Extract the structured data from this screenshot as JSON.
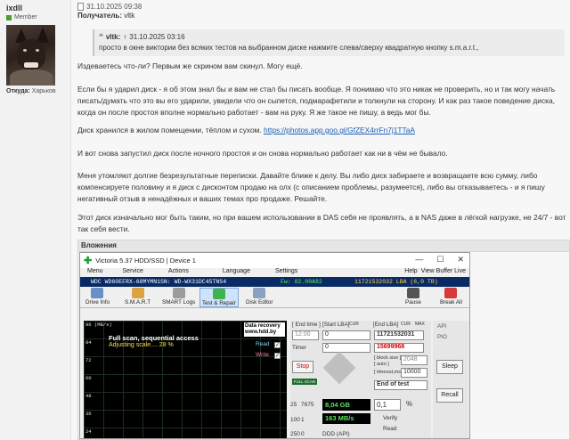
{
  "user": {
    "name": "ixdll",
    "role": "Member",
    "location_label": "Откуда:",
    "location_value": "Харьков"
  },
  "post": {
    "date": "31.10.2025 09:38",
    "recipient_label": "Получатель:",
    "recipient_value": "vltk",
    "quote": {
      "author": "vltk:",
      "arrow": "↑",
      "date": "31.10.2025 03:16",
      "text": "просто в окне виктории без всяких тестов на выбранном диске нажмите слева/сверху квадратную кнопку s.m.a.r.t.,"
    },
    "paragraphs": [
      "Издеваетесь что-ли? Первым же скрином вам скинул. Могу ещё.",
      "Если бы я ударил диск - я об этом знал бы и вам не стал бы писать вообще. Я понимаю что это никак не проверить, но и так могу начать писать/думать что это вы его ударили, увидели что он сыпется, подмарафетили и толкнули на сторону. И как раз такое поведение диска, когда он после простоя вполне нормально работает - вам на руку. Я же такое не пишу, а ведь мог бы.",
      "Диск хранился в жилом помещении, тёплом и сухом.",
      "И вот снова запустил диск после ночного простоя и он снова нормально работает как ни в чём не бывало.",
      "Меня утомляют долгие безрезультатные переписки. Давайте ближе к делу. Вы либо диск забираете и возвращаете всю сумму, либо компенсируете половину и я диск с дисконтом продаю на олх (с описанием проблемы, разумеется), либо вы отказываетесь - и я пишу негативный отзыв в ненадёжных и ваших темах про продаже. Решайте.",
      "Этот диск изначально мог быть таким, но при вашем использовании в DAS себя не проявлять, а в NAS даже в лёгкой нагрузке, не 24/7 - вот так себя вести."
    ],
    "link": "https://photos.app.goo.gl/GfZEX4rrFn7j1TTaA",
    "attachments_title": "Вложения"
  },
  "victoria": {
    "title": "Victoria 5.37 HDD/SSD | Device 1",
    "menu": [
      "Menu",
      "Service",
      "Actions",
      "Language",
      "Settings",
      "Help"
    ],
    "view_buffer": "View Buffer Live",
    "drive_model": "WDC WD60EFRX-68MYMN1",
    "drive_sn": "SN: WD-WX31DC45TNS4",
    "drive_fw": "Fw: 82.00A82",
    "drive_lba": "11721532032 LBA (6,0 TB)",
    "toolbar": [
      "Drive Info",
      "S.M.A.R.T",
      "SMART Logs",
      "Test & Repair",
      "Disk Editor",
      "Pause",
      "Break All"
    ],
    "graph_unit": "96 (MB/s)",
    "graph_ticks": [
      "84",
      "72",
      "60",
      "48",
      "36",
      "24"
    ],
    "scan_title": "Full scan, sequential access",
    "scan_status": "Adjusting scale.... 28 %",
    "recovery_label": "Data recovery www.hdd.by",
    "read_label": "Read",
    "write_label": "Write",
    "end_time_label": "[ End time ]",
    "start_lba_label": "[Start LBA]",
    "end_lba_label": "[End LBA]",
    "cur_label": "CUR",
    "max_label": "MAX",
    "time_value": "12:00",
    "start_lba": "0",
    "end_lba": "11721532031",
    "cur_val": "0",
    "cur_val2": "15699968",
    "timer_label": "Timer",
    "timer_val": "0",
    "block_size_label": "[ block size ]",
    "auto_label": "[ auto ]",
    "block_size": "2048",
    "timeout_label": "[ timeout,ms ]",
    "timeout": "10000",
    "stop_label": "Stop",
    "full_scan": "FULL SCAN",
    "end_of_test": "End of test",
    "row_25": "25",
    "row_7675": "7675",
    "row_100": "100",
    "row_1": "1",
    "row_250": "250",
    "row_0": "0",
    "size_done": "8,04 GB",
    "percent": "0,1",
    "percent_unit": "%",
    "speed": "163 MB/s",
    "verify": "Verify",
    "read": "Read",
    "ddd": "DDD (API)",
    "api": "API",
    "pio": "PIO",
    "sleep": "Sleep",
    "recall": "Recall"
  }
}
